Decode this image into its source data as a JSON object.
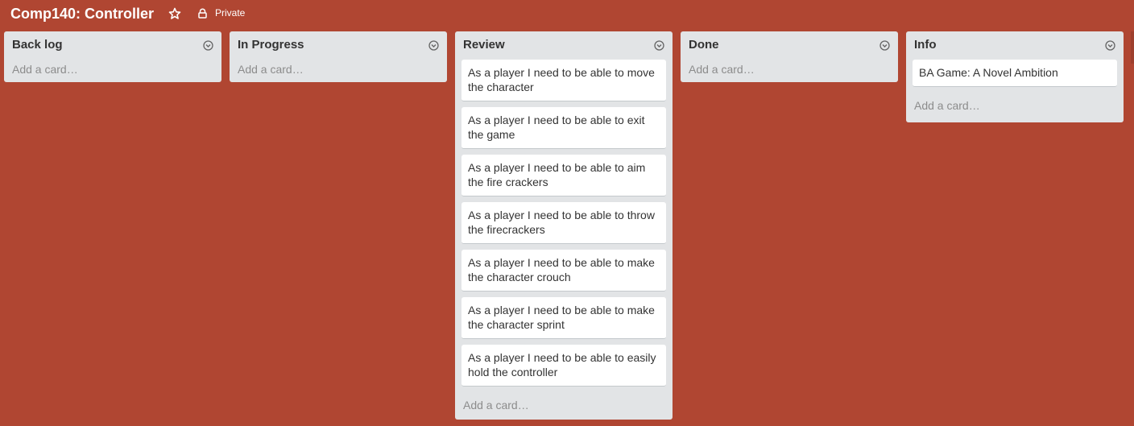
{
  "board": {
    "title": "Comp140: Controller",
    "star_icon": "star-icon",
    "privacy_icon": "lock-icon",
    "privacy_label": "Private",
    "background_color": "#b04632"
  },
  "lists": [
    {
      "title": "Back log",
      "menu_icon": "chevron-down-circle-icon",
      "cards": [],
      "add_card_label": "Add a card…"
    },
    {
      "title": "In Progress",
      "menu_icon": "chevron-down-circle-icon",
      "cards": [],
      "add_card_label": "Add a card…"
    },
    {
      "title": "Review",
      "menu_icon": "chevron-down-circle-icon",
      "cards": [
        "As a player I need to be able to move the character",
        "As a player I need to be able to exit the game",
        "As a player I need to be able to aim the fire crackers",
        "As a player I need to be able to throw the firecrackers",
        "As a player I need to be able to make the character crouch",
        "As a player I need to be able to make the character sprint",
        "As a player I need to be able to easily hold the controller"
      ],
      "add_card_label": "Add a card…"
    },
    {
      "title": "Done",
      "menu_icon": "chevron-down-circle-icon",
      "cards": [],
      "add_card_label": "Add a card…"
    },
    {
      "title": "Info",
      "menu_icon": "chevron-down-circle-icon",
      "cards": [
        "BA Game: A Novel Ambition"
      ],
      "add_card_label": "Add a card…"
    }
  ]
}
